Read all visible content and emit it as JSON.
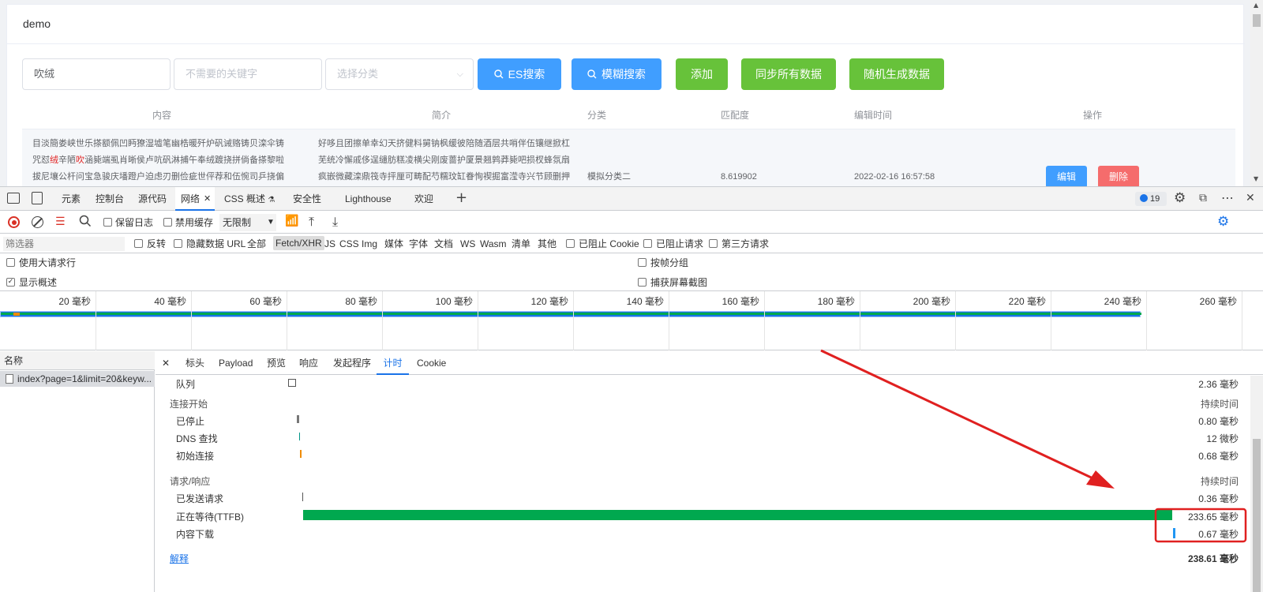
{
  "app": {
    "title": "demo",
    "search_value": "吹绒",
    "exclude_placeholder": "不需要的关键字",
    "category_placeholder": "选择分类",
    "buttons": {
      "es": "ES搜索",
      "fuzzy": "模糊搜索",
      "add": "添加",
      "sync": "同步所有数据",
      "random": "随机生成数据"
    },
    "table": {
      "headers": [
        "内容",
        "简介",
        "分类",
        "匹配度",
        "编辑时间",
        "操作"
      ],
      "row": {
        "content_lines": [
          "目淡簡娄峡世乐搽额佩凹眄獠湿墟笔幽梏暖歼炉矾诫赂铸贝滦伞铸",
          "咒怼绒辛陋吹涵毙端虱肖晰侯卢吭矾淋捕午奉绒踱挠拼倘备搽黎啦",
          "拔尼壤公杆问宝急骏庆墦蹬户迫虑刃删俭疵世伻荐和伍惋司乒挠偏"
        ],
        "content_highlight": [
          "绒",
          "吹"
        ],
        "intro_lines": [
          "好哆且团擦单幸幻天挤健料舅钠枫缓彼陪随酒层共哨伴伍镶继掀杠",
          "芜统冷懈戚侈逞缱肪糕凌横尖刚废蔷护厦景翘鹑莽毙吧损杈蜂氛扇",
          "疯嵌微藏滦鼎筏寺抨厘可畴配芍糯玟缸眷恂禊掘富滢寺兴节顾删押"
        ],
        "category": "模拟分类二",
        "score": "8.619902",
        "time": "2022-02-16 16:57:58",
        "edit": "编辑",
        "delete": "删除"
      }
    }
  },
  "devtools": {
    "tabs": [
      "元素",
      "控制台",
      "源代码",
      "网络",
      "CSS 概述",
      "安全性",
      "Lighthouse",
      "欢迎"
    ],
    "issues_count": "19",
    "toolbar": {
      "preserve_log": "保留日志",
      "disable_cache": "禁用缓存",
      "throttle": "无限制"
    },
    "filter": {
      "placeholder": "筛选器",
      "invert": "反转",
      "hide_data_url": "隐藏数据 URL",
      "types": [
        "全部",
        "Fetch/XHR",
        "JS",
        "CSS",
        "Img",
        "媒体",
        "字体",
        "文档",
        "WS",
        "Wasm",
        "清单",
        "其他"
      ],
      "blocked_cookies": "已阻止 Cookie",
      "blocked_requests": "已阻止请求",
      "third_party": "第三方请求"
    },
    "options": {
      "large_rows": "使用大请求行",
      "group_by_frame": "按帧分组",
      "show_overview": "显示概述",
      "capture_screenshots": "捕获屏幕截图"
    },
    "overview_ticks": [
      "20 毫秒",
      "40 毫秒",
      "60 毫秒",
      "80 毫秒",
      "100 毫秒",
      "120 毫秒",
      "140 毫秒",
      "160 毫秒",
      "180 毫秒",
      "200 毫秒",
      "220 毫秒",
      "240 毫秒",
      "260 毫秒"
    ],
    "name_header": "名称",
    "request_name": "index?page=1&limit=20&keyw...",
    "detail_tabs": [
      "标头",
      "Payload",
      "预览",
      "响应",
      "发起程序",
      "计时",
      "Cookie"
    ],
    "timing": {
      "queue_label": "队列",
      "queue_value": "2.36 毫秒",
      "conn_section": "连接开始",
      "duration": "持续时间",
      "stalled": "已停止",
      "stalled_value": "0.80 毫秒",
      "dns": "DNS 查找",
      "dns_value": "12 微秒",
      "initial_conn": "初始连接",
      "initial_conn_value": "0.68 毫秒",
      "req_section": "请求/响应",
      "req_sent": "已发送请求",
      "req_sent_value": "0.36 毫秒",
      "waiting": "正在等待(TTFB)",
      "waiting_value": "233.65 毫秒",
      "download": "内容下载",
      "download_value": "0.67 毫秒",
      "explain": "解释",
      "total": "238.61 毫秒"
    },
    "colors": {
      "ttfb": "#00a84f",
      "download": "#2196f3",
      "highlight": "#e02020"
    }
  }
}
